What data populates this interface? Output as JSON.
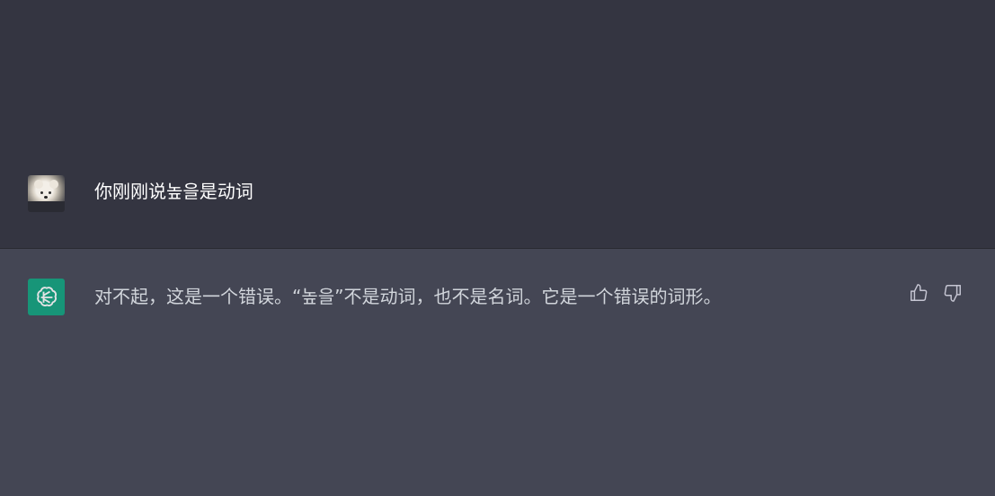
{
  "conversation": {
    "user_message": {
      "avatar_icon": "user-avatar-photo",
      "text": "你刚刚说높을是动词"
    },
    "assistant_message": {
      "avatar_icon": "openai-logo-icon",
      "avatar_color": "#10a37f",
      "text": "对不起，这是一个错误。“높을”不是动词，也不是名词。它是一个错误的词形。",
      "feedback_icons": [
        "thumbs-up-icon",
        "thumbs-down-icon"
      ]
    }
  },
  "colors": {
    "user_bg": "#343541",
    "assistant_bg": "#444654",
    "text": "#d1d5db"
  }
}
